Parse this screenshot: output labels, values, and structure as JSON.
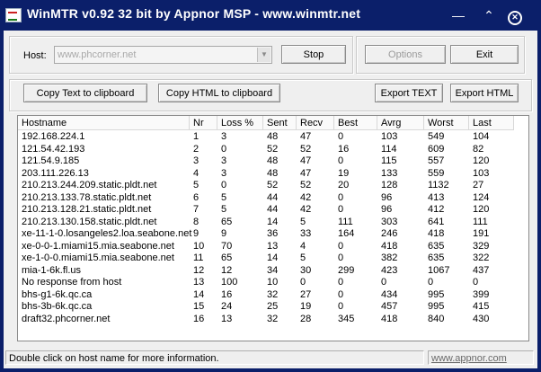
{
  "window": {
    "title": "WinMTR v0.92 32 bit by Appnor MSP - www.winmtr.net"
  },
  "titlebar_icons": [
    "winmtr-app-icon",
    "minimize-icon",
    "chevron-up-icon",
    "close-icon"
  ],
  "host": {
    "label": "Host:",
    "value": "www.phcorner.net",
    "stop_label": "Stop",
    "options_label": "Options",
    "exit_label": "Exit"
  },
  "export": {
    "copy_text_label": "Copy Text to clipboard",
    "copy_html_label": "Copy HTML to clipboard",
    "export_text_label": "Export TEXT",
    "export_html_label": "Export HTML"
  },
  "table": {
    "columns": [
      "Hostname",
      "Nr",
      "Loss %",
      "Sent",
      "Recv",
      "Best",
      "Avrg",
      "Worst",
      "Last"
    ],
    "rows": [
      [
        "192.168.224.1",
        "1",
        "3",
        "48",
        "47",
        "0",
        "103",
        "549",
        "104"
      ],
      [
        "121.54.42.193",
        "2",
        "0",
        "52",
        "52",
        "16",
        "114",
        "609",
        "82"
      ],
      [
        "121.54.9.185",
        "3",
        "3",
        "48",
        "47",
        "0",
        "115",
        "557",
        "120"
      ],
      [
        "203.111.226.13",
        "4",
        "3",
        "48",
        "47",
        "19",
        "133",
        "559",
        "103"
      ],
      [
        "210.213.244.209.static.pldt.net",
        "5",
        "0",
        "52",
        "52",
        "20",
        "128",
        "1132",
        "27"
      ],
      [
        "210.213.133.78.static.pldt.net",
        "6",
        "5",
        "44",
        "42",
        "0",
        "96",
        "413",
        "124"
      ],
      [
        "210.213.128.21.static.pldt.net",
        "7",
        "5",
        "44",
        "42",
        "0",
        "96",
        "412",
        "120"
      ],
      [
        "210.213.130.158.static.pldt.net",
        "8",
        "65",
        "14",
        "5",
        "111",
        "303",
        "641",
        "111"
      ],
      [
        "xe-11-1-0.losangeles2.loa.seabone.net",
        "9",
        "9",
        "36",
        "33",
        "164",
        "246",
        "418",
        "191"
      ],
      [
        "xe-0-0-1.miami15.mia.seabone.net",
        "10",
        "70",
        "13",
        "4",
        "0",
        "418",
        "635",
        "329"
      ],
      [
        "xe-1-0-0.miami15.mia.seabone.net",
        "11",
        "65",
        "14",
        "5",
        "0",
        "382",
        "635",
        "322"
      ],
      [
        "mia-1-6k.fl.us",
        "12",
        "12",
        "34",
        "30",
        "299",
        "423",
        "1067",
        "437"
      ],
      [
        "No response from host",
        "13",
        "100",
        "10",
        "0",
        "0",
        "0",
        "0",
        "0"
      ],
      [
        "bhs-g1-6k.qc.ca",
        "14",
        "16",
        "32",
        "27",
        "0",
        "434",
        "995",
        "399"
      ],
      [
        "bhs-3b-6k.qc.ca",
        "15",
        "24",
        "25",
        "19",
        "0",
        "457",
        "995",
        "415"
      ],
      [
        "draft32.phcorner.net",
        "16",
        "13",
        "32",
        "28",
        "345",
        "418",
        "840",
        "430"
      ]
    ]
  },
  "status": {
    "text": "Double click on host name for more information.",
    "link": "www.appnor.com"
  }
}
